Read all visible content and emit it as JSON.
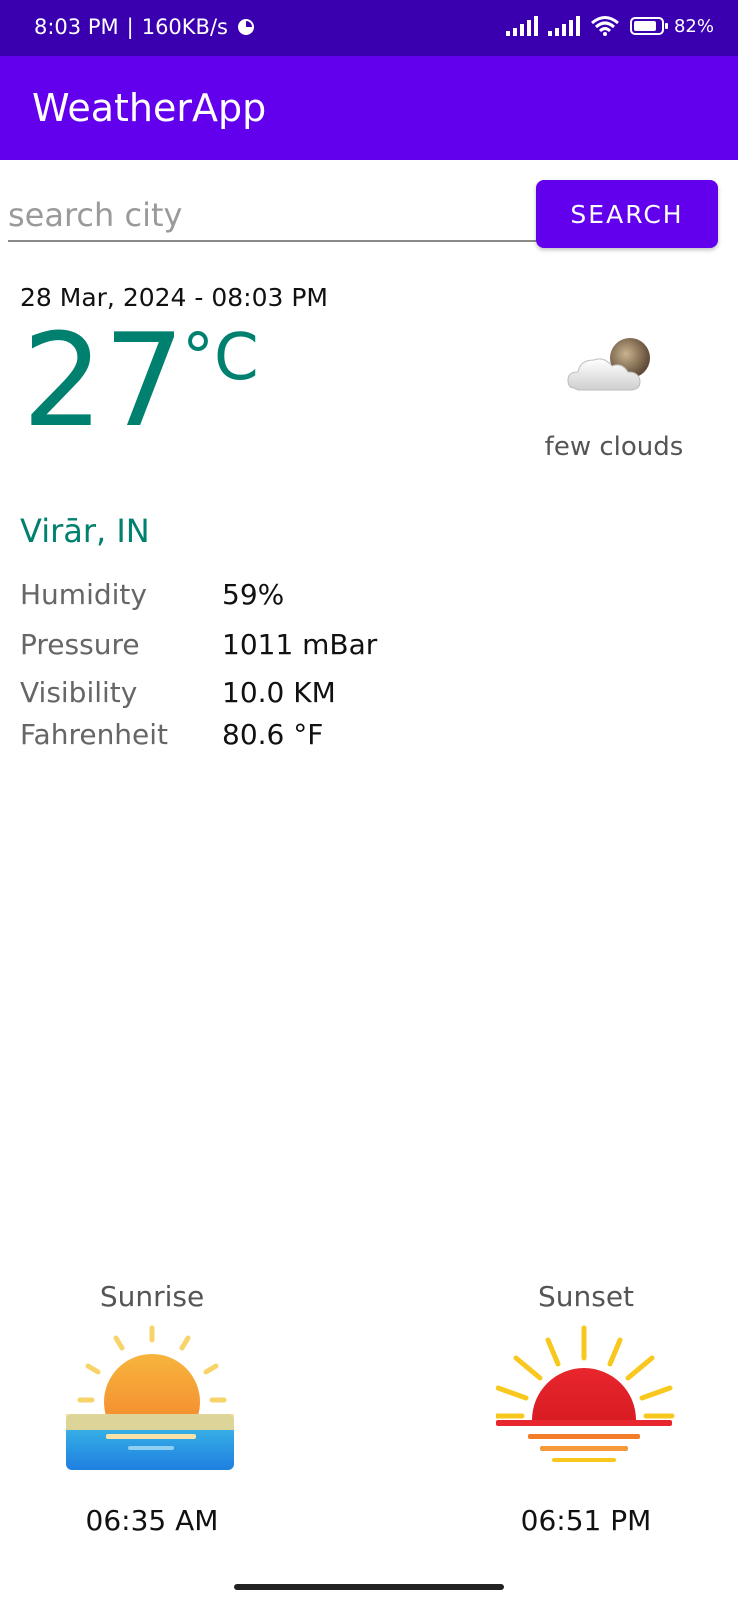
{
  "status_bar": {
    "time": "8:03 PM",
    "speed": "160KB/s",
    "battery": "82%"
  },
  "app_bar": {
    "title": "WeatherApp"
  },
  "search": {
    "placeholder": "search city",
    "button_label": "SEARCH"
  },
  "weather": {
    "datetime": "28 Mar, 2024 - 08:03 PM",
    "temperature": "27",
    "unit": "°C",
    "description": "few clouds",
    "location": "Virār, IN",
    "details": [
      {
        "label": "Humidity",
        "value": "59%"
      },
      {
        "label": "Pressure",
        "value": "1011 mBar"
      },
      {
        "label": "Visibility",
        "value": "10.0 KM"
      },
      {
        "label": "Fahrenheit",
        "value": "80.6 °F"
      }
    ]
  },
  "sun": {
    "sunrise_label": "Sunrise",
    "sunrise_time": "06:35 AM",
    "sunset_label": "Sunset",
    "sunset_time": "06:51 PM"
  },
  "icons": {
    "weather": "few-clouds-night-icon",
    "sunrise": "sunrise-icon",
    "sunset": "sunset-icon"
  },
  "colors": {
    "primary": "#6200ee",
    "status_bar": "#3a00b0",
    "accent_text": "#00806e"
  }
}
